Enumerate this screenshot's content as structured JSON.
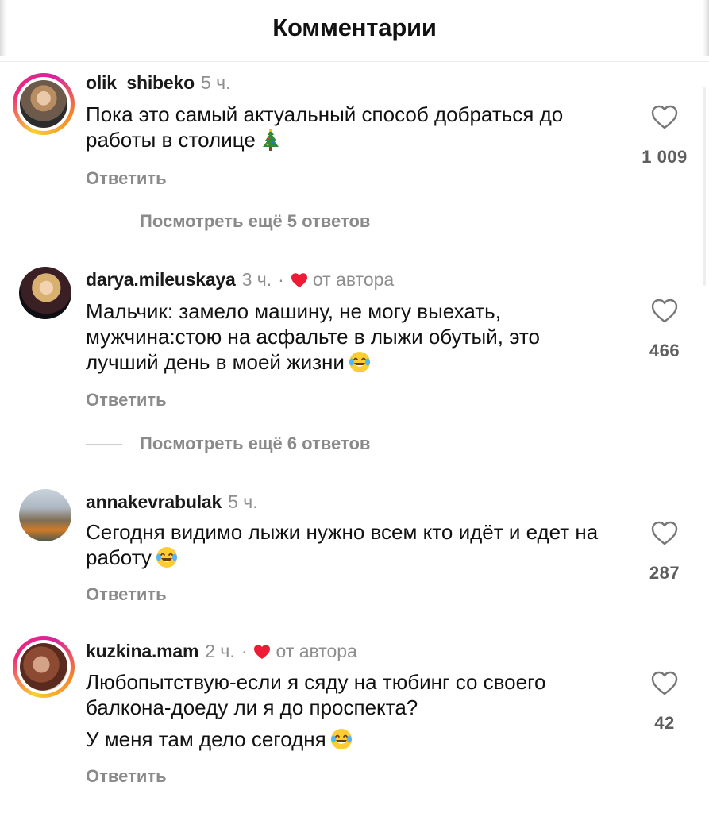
{
  "header": {
    "title": "Комментарии"
  },
  "comments": [
    {
      "username": "olik_shibeko",
      "time": "5 ч.",
      "author_liked": false,
      "text_lines": [
        "Пока это самый актуальный способ добраться до работы в столице"
      ],
      "emoji": "christmas-tree",
      "likes": "1 009",
      "reply_label": "Ответить",
      "more_replies": "Посмотреть ещё 5 ответов",
      "has_story": true
    },
    {
      "username": "darya.mileuskaya",
      "time": "3 ч.",
      "separator": "·",
      "author_liked": true,
      "author_label": "от автора",
      "text_lines": [
        "Мальчик: замело машину, не могу выехать, мужчина:стою на асфальте в лыжи обутый, это лучший день в моей жизни"
      ],
      "emoji": "tears-of-joy",
      "likes": "466",
      "reply_label": "Ответить",
      "more_replies": "Посмотреть ещё 6 ответов",
      "has_story": false
    },
    {
      "username": "annakevrabulak",
      "time": "5 ч.",
      "author_liked": false,
      "text_lines": [
        "Сегодня видимо лыжи нужно всем кто идёт и едет на работу"
      ],
      "emoji": "tears-of-joy",
      "likes": "287",
      "reply_label": "Ответить",
      "has_story": false
    },
    {
      "username": "kuzkina.mam",
      "time": "2 ч.",
      "separator": "·",
      "author_liked": true,
      "author_label": "от автора",
      "text_lines": [
        "Любопытствую-если я сяду на тюбинг со своего балкона-доеду ли я до проспекта?",
        "У меня там дело сегодня"
      ],
      "emoji": "tears-of-joy",
      "likes": "42",
      "reply_label": "Ответить",
      "has_story": true
    }
  ],
  "icons": {
    "like": "heart-outline-icon",
    "author_heart": "heart-filled-icon",
    "author_heart_color": "#ed1c34"
  }
}
